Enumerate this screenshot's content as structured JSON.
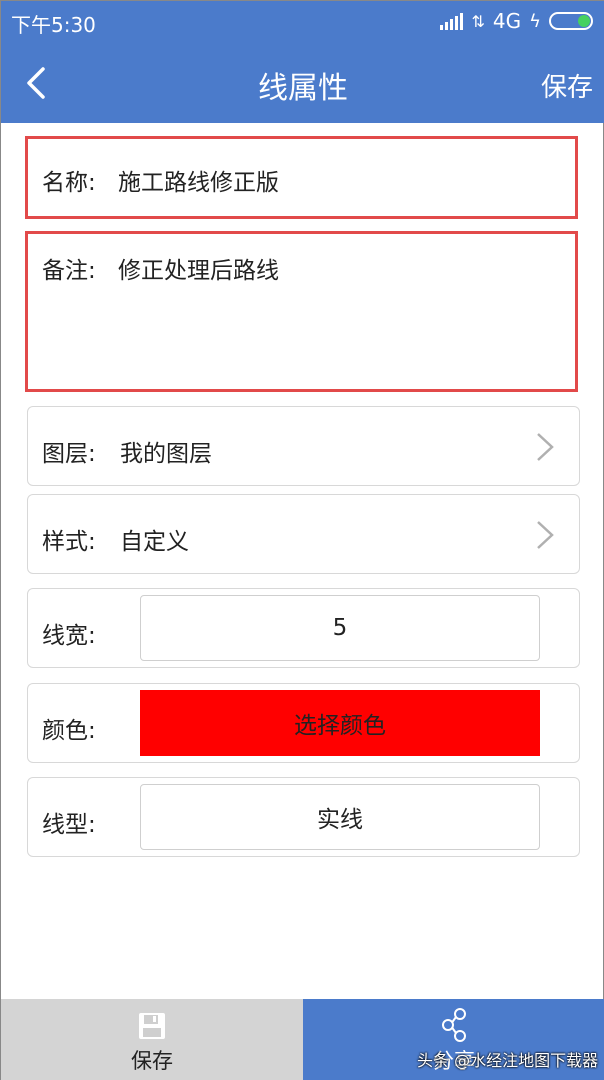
{
  "status": {
    "time": "下午5:30",
    "network": "4G"
  },
  "nav": {
    "title": "线属性",
    "save_label": "保存"
  },
  "form": {
    "name_label": "名称:",
    "name_value": "施工路线修正版",
    "remark_label": "备注:",
    "remark_value": "修正处理后路线",
    "layer_label": "图层:",
    "layer_value": "我的图层",
    "style_label": "样式:",
    "style_value": "自定义",
    "width_label": "线宽:",
    "width_value": "5",
    "color_label": "颜色:",
    "color_button": "选择颜色",
    "color_value": "#ff0000",
    "linetype_label": "线型:",
    "linetype_value": "实线"
  },
  "tabs": {
    "save_label": "保存",
    "share_label": "分享"
  },
  "watermark": "头条 @水经注地图下载器",
  "colors": {
    "accent": "#4b7bcb",
    "highlight_border": "#e24a4a"
  }
}
